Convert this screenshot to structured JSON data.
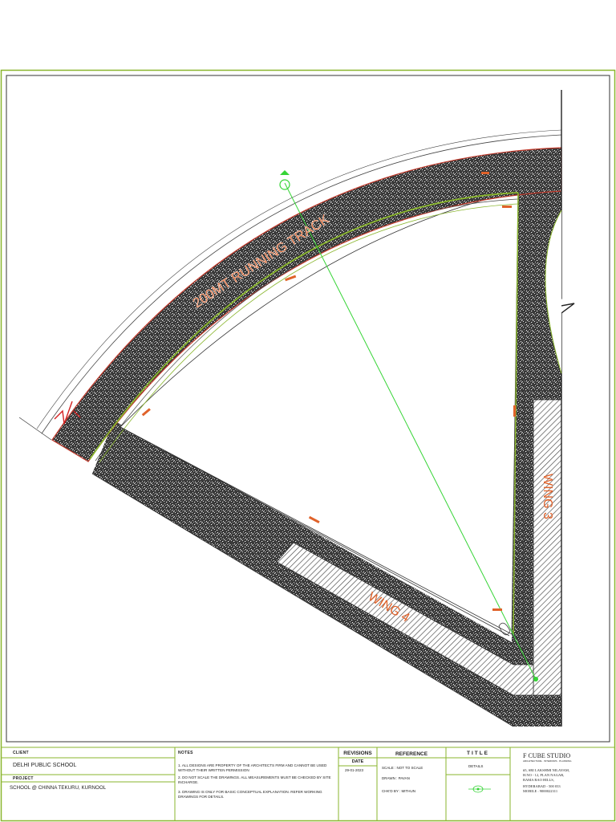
{
  "drawing": {
    "track_label": "200MT RUNNING TRACK",
    "wing_3_label": "WING 3",
    "wing_4_label": "WING 4",
    "colors": {
      "frame": "#8ab62e",
      "track_text": "#e0622a",
      "centerline": "#36d436",
      "track_edge": "#c0392b",
      "hatch": "#444444"
    }
  },
  "title_block": {
    "client_label": "CLIENT",
    "client": "DELHI PUBLIC SCHOOL",
    "project_label": "PROJECT",
    "project": "SCHOOL @ CHINNA TEKURU, KURNOOL",
    "notes_label": "NOTES",
    "notes": [
      "1. ALL DESIGNS ARE PROPERTY OF THE ARCHITECTS FIRM AND CANNOT BE USED WITHOUT THEIR WRITTEN PERMISSION",
      "2. DO NOT SCALE THE DRAWINGS. ALL MEASUREMENTS MUST BE CHECKED BY SITE INCHARGE.",
      "3. DRAWING IS ONLY FOR BASIC CONCEPTUAL EXPLANATION. REFER WORKING DRAWINGS FOR DETAILS."
    ],
    "revisions_label": "REVISIONS",
    "date_label": "DATE",
    "date": "29-01-2023",
    "reference_label": "REFERENCE",
    "scale": "SCALE : NOT TO SCALE",
    "drawn": "DRAWN : PAVAN",
    "checked": "CHK'D BY : MITHUN",
    "title_label": "TITLE",
    "title_value": "DETAILS",
    "studio_name": "F CUBE STUDIO",
    "studio_tagline": "ARCHITECTURE · INTERIORS · PLANNING",
    "studio_address": [
      "#5, SRI LAKSHMI NILAYAM,",
      "H.NO - 12, PLAN NAGAR,",
      "RAMA RAO HILLS,",
      "HYDERABAD - 500 033",
      "MOBILE : 9000022311"
    ]
  }
}
